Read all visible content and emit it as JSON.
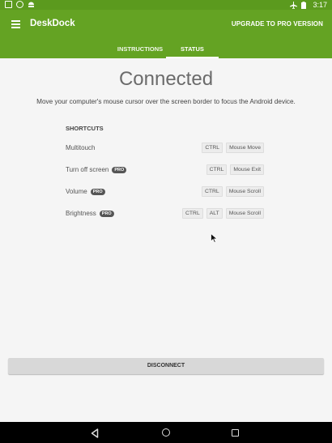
{
  "status_bar": {
    "time": "3:17"
  },
  "app_bar": {
    "title": "DeskDock",
    "upgrade_label": "UPGRADE TO PRO VERSION",
    "tabs": [
      {
        "label": "INSTRUCTIONS",
        "selected": false
      },
      {
        "label": "STATUS",
        "selected": true
      }
    ]
  },
  "main": {
    "connection_state": "Connected",
    "instruction": "Move your computer's mouse cursor over the screen border to focus the Android device.",
    "shortcuts_title": "SHORTCUTS",
    "shortcuts": [
      {
        "label": "Multitouch",
        "pro": "",
        "keys": [
          "CTRL",
          "Mouse Move"
        ]
      },
      {
        "label": "Turn off screen",
        "pro": "PRO",
        "keys": [
          "CTRL",
          "Mouse Exit"
        ]
      },
      {
        "label": "Volume",
        "pro": "PRO",
        "keys": [
          "CTRL",
          "Mouse Scroll"
        ]
      },
      {
        "label": "Brightness",
        "pro": "PRO",
        "keys": [
          "CTRL",
          "ALT",
          "Mouse Scroll"
        ]
      }
    ],
    "disconnect_label": "DISCONNECT"
  },
  "colors": {
    "primary": "#64a323",
    "status_bar": "#5b9a1e"
  },
  "icons": {
    "status_left": [
      "checkbox-icon",
      "chrome-icon",
      "android-icon"
    ],
    "status_right": [
      "airplane-icon",
      "battery-icon"
    ],
    "nav": [
      "back-icon",
      "home-icon",
      "recents-icon"
    ]
  }
}
